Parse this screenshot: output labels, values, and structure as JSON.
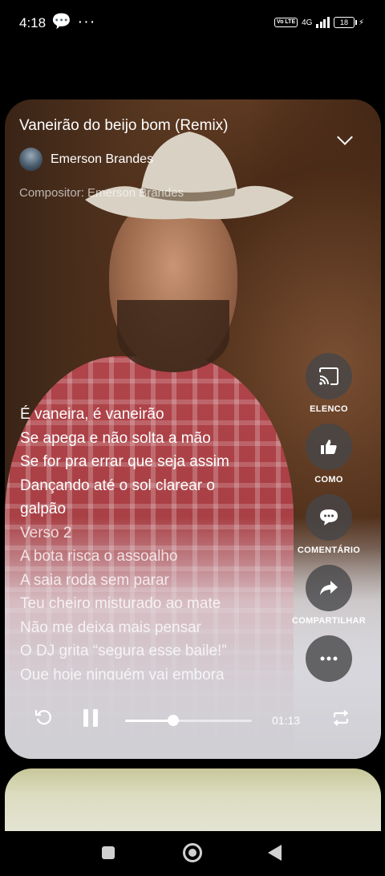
{
  "status_bar": {
    "time": "4:18",
    "notification_icons": "💬 ···",
    "network_type": "4G",
    "volte_label": "Vo LTE",
    "battery_level": "18"
  },
  "song": {
    "title": "Vaneirão do beijo bom (Remix)",
    "artist": "Emerson Brandes",
    "composer": "Compositor: Emerson Brandes"
  },
  "lyrics": [
    "É vaneira, é vaneirão",
    "Se apega e não solta a mão",
    "Se for pra errar que seja assim",
    "Dançando até o sol clarear o",
    "galpão",
    "Verso 2",
    "A bota risca o assoalho",
    "A saia roda sem parar",
    "Teu cheiro misturado ao mate",
    "Não me deixa mais pensar",
    "O DJ grita “segura esse baile!”",
    "Que hoje ninguém vai embora"
  ],
  "actions": {
    "cast_label": "ELENCO",
    "like_label": "COMO",
    "comment_label": "COMENTÁRIO",
    "share_label": "COMPARTILHAR"
  },
  "player": {
    "elapsed": "01:13",
    "progress_fraction": 0.38
  },
  "icons": [
    "chevron-down-icon",
    "cast-icon",
    "thumbs-up-icon",
    "comment-icon",
    "share-icon",
    "more-icon",
    "replay-icon",
    "pause-icon",
    "repeat-icon"
  ],
  "colors": {
    "accent": "#ffffff",
    "button_bg": "#464648"
  }
}
